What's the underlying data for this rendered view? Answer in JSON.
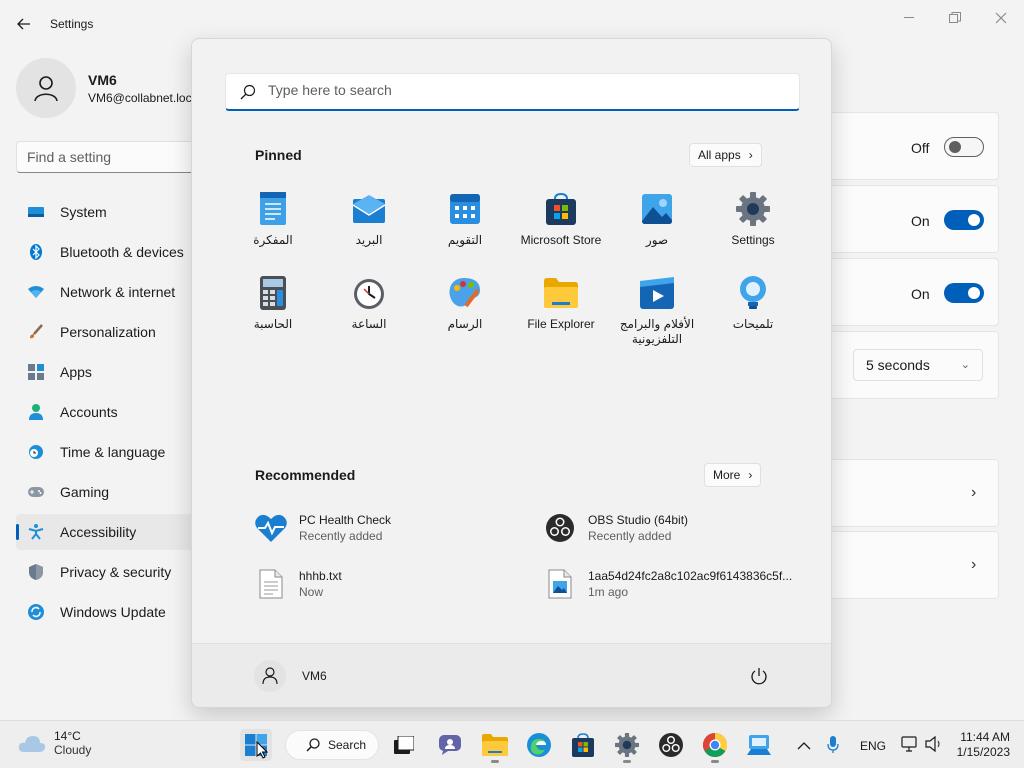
{
  "settings": {
    "app_title": "Settings",
    "profile": {
      "name": "VM6",
      "email": "VM6@collabnet.loc"
    },
    "find_placeholder": "Find a setting",
    "nav": [
      {
        "label": "System",
        "icon": "system-icon"
      },
      {
        "label": "Bluetooth & devices",
        "icon": "bluetooth-icon"
      },
      {
        "label": "Network & internet",
        "icon": "wifi-icon"
      },
      {
        "label": "Personalization",
        "icon": "brush-icon"
      },
      {
        "label": "Apps",
        "icon": "apps-icon"
      },
      {
        "label": "Accounts",
        "icon": "person-icon"
      },
      {
        "label": "Time & language",
        "icon": "clock-globe-icon"
      },
      {
        "label": "Gaming",
        "icon": "controller-icon"
      },
      {
        "label": "Accessibility",
        "icon": "accessibility-icon",
        "active": true
      },
      {
        "label": "Privacy & security",
        "icon": "shield-icon"
      },
      {
        "label": "Windows Update",
        "icon": "update-icon"
      }
    ],
    "toggles": [
      {
        "label": "Off",
        "state": false
      },
      {
        "label": "On",
        "state": true
      },
      {
        "label": "On",
        "state": true
      }
    ],
    "dropdown_value": "5 seconds"
  },
  "start": {
    "search_placeholder": "Type here to search",
    "pinned_title": "Pinned",
    "all_apps_label": "All apps",
    "pinned": [
      {
        "label": "المفكرة",
        "icon": "notepad-icon"
      },
      {
        "label": "البريد",
        "icon": "mail-icon"
      },
      {
        "label": "التقويم",
        "icon": "calendar-icon"
      },
      {
        "label": "Microsoft Store",
        "icon": "store-icon"
      },
      {
        "label": "صور",
        "icon": "photos-icon"
      },
      {
        "label": "Settings",
        "icon": "settings-gear-icon"
      },
      {
        "label": "الحاسبة",
        "icon": "calculator-icon"
      },
      {
        "label": "الساعة",
        "icon": "alarm-clock-icon"
      },
      {
        "label": "الرسام",
        "icon": "paint-icon"
      },
      {
        "label": "File Explorer",
        "icon": "folder-icon"
      },
      {
        "label": "الأفلام والبرامج التلفزيونية",
        "icon": "movies-icon"
      },
      {
        "label": "تلميحات",
        "icon": "tips-icon"
      }
    ],
    "recommended_title": "Recommended",
    "more_label": "More",
    "recommended": [
      {
        "name": "PC Health Check",
        "sub": "Recently added",
        "icon": "health-heart-icon"
      },
      {
        "name": "OBS Studio (64bit)",
        "sub": "Recently added",
        "icon": "obs-icon"
      },
      {
        "name": "hhhb.txt",
        "sub": "Now",
        "icon": "text-file-icon"
      },
      {
        "name": "1aa54d24fc2a8c102ac9f6143836c5f...",
        "sub": "1m ago",
        "icon": "image-file-icon"
      }
    ],
    "user_name": "VM6"
  },
  "taskbar": {
    "weather_temp": "14°C",
    "weather_desc": "Cloudy",
    "search_label": "Search",
    "lang": "ENG",
    "time": "11:44 AM",
    "date": "1/15/2023"
  },
  "colors": {
    "accent": "#005fb8",
    "background": "#f3f3f3"
  }
}
